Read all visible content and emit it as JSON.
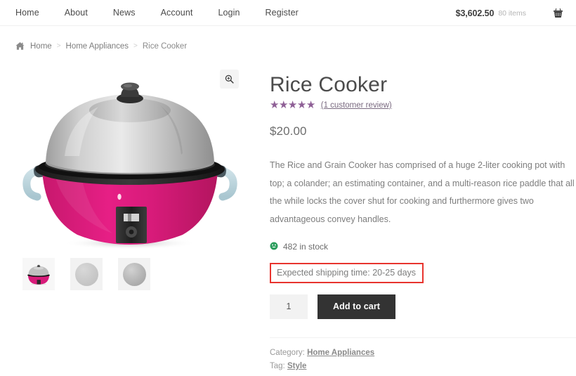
{
  "nav": {
    "links": [
      {
        "label": "Home"
      },
      {
        "label": "About"
      },
      {
        "label": "News"
      },
      {
        "label": "Account"
      },
      {
        "label": "Login"
      },
      {
        "label": "Register"
      }
    ],
    "cart": {
      "total": "$3,602.50",
      "count": "80 items",
      "icon": "shopping-basket-icon"
    }
  },
  "breadcrumb": {
    "home_icon": "home-icon",
    "items": [
      {
        "label": "Home"
      },
      {
        "label": "Home Appliances"
      },
      {
        "label": "Rice Cooker"
      }
    ],
    "separator": ">"
  },
  "gallery": {
    "zoom_icon": "magnifier-zoom-in-icon",
    "main_image_alt": "Rice Cooker",
    "thumbnails": [
      {
        "name": "thumbnail-product",
        "type": "product"
      },
      {
        "name": "thumbnail-placeholder-1",
        "type": "placeholder-light"
      },
      {
        "name": "thumbnail-placeholder-2",
        "type": "placeholder-dark"
      }
    ]
  },
  "product": {
    "title": "Rice Cooker",
    "rating": {
      "stars": "★★★★★",
      "star_count": 5,
      "star_color": "#8e5f96",
      "review_link": "(1 customer review)"
    },
    "price": "$20.00",
    "description": "The Rice and Grain Cooker has comprised of a huge 2-liter cooking pot with top; a colander; an estimating container, and a multi-reason rice paddle that all the while locks the cover shut for cooking and furthermore gives two advantageous convey handles.",
    "stock": {
      "emoji": "green-smiley-icon",
      "text": "482 in stock"
    },
    "shipping": {
      "text": "Expected shipping time: 20-25 days",
      "highlight_color": "#e8342e"
    },
    "quantity": {
      "value": "1",
      "placeholder": "1"
    },
    "add_to_cart_label": "Add to cart",
    "meta": {
      "category_label": "Category:",
      "category_value": "Home Appliances",
      "tag_label": "Tag:",
      "tag_value": "Style"
    }
  },
  "colors": {
    "cooker_body": "#d81b7a",
    "cooker_lid": "#b8b8b8",
    "button_dark": "#333333",
    "stock_green": "#2a9d5c"
  }
}
